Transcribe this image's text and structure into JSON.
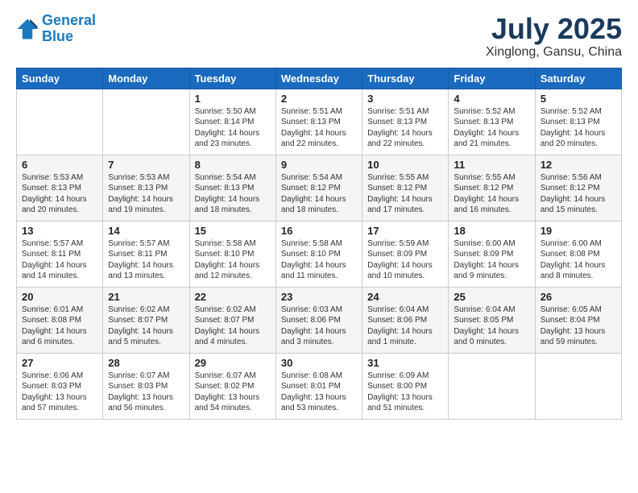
{
  "logo": {
    "line1": "General",
    "line2": "Blue"
  },
  "title": "July 2025",
  "location": "Xinglong, Gansu, China",
  "weekdays": [
    "Sunday",
    "Monday",
    "Tuesday",
    "Wednesday",
    "Thursday",
    "Friday",
    "Saturday"
  ],
  "weeks": [
    [
      {
        "day": "",
        "info": ""
      },
      {
        "day": "",
        "info": ""
      },
      {
        "day": "1",
        "info": "Sunrise: 5:50 AM\nSunset: 8:14 PM\nDaylight: 14 hours\nand 23 minutes."
      },
      {
        "day": "2",
        "info": "Sunrise: 5:51 AM\nSunset: 8:13 PM\nDaylight: 14 hours\nand 22 minutes."
      },
      {
        "day": "3",
        "info": "Sunrise: 5:51 AM\nSunset: 8:13 PM\nDaylight: 14 hours\nand 22 minutes."
      },
      {
        "day": "4",
        "info": "Sunrise: 5:52 AM\nSunset: 8:13 PM\nDaylight: 14 hours\nand 21 minutes."
      },
      {
        "day": "5",
        "info": "Sunrise: 5:52 AM\nSunset: 8:13 PM\nDaylight: 14 hours\nand 20 minutes."
      }
    ],
    [
      {
        "day": "6",
        "info": "Sunrise: 5:53 AM\nSunset: 8:13 PM\nDaylight: 14 hours\nand 20 minutes."
      },
      {
        "day": "7",
        "info": "Sunrise: 5:53 AM\nSunset: 8:13 PM\nDaylight: 14 hours\nand 19 minutes."
      },
      {
        "day": "8",
        "info": "Sunrise: 5:54 AM\nSunset: 8:13 PM\nDaylight: 14 hours\nand 18 minutes."
      },
      {
        "day": "9",
        "info": "Sunrise: 5:54 AM\nSunset: 8:12 PM\nDaylight: 14 hours\nand 18 minutes."
      },
      {
        "day": "10",
        "info": "Sunrise: 5:55 AM\nSunset: 8:12 PM\nDaylight: 14 hours\nand 17 minutes."
      },
      {
        "day": "11",
        "info": "Sunrise: 5:55 AM\nSunset: 8:12 PM\nDaylight: 14 hours\nand 16 minutes."
      },
      {
        "day": "12",
        "info": "Sunrise: 5:56 AM\nSunset: 8:12 PM\nDaylight: 14 hours\nand 15 minutes."
      }
    ],
    [
      {
        "day": "13",
        "info": "Sunrise: 5:57 AM\nSunset: 8:11 PM\nDaylight: 14 hours\nand 14 minutes."
      },
      {
        "day": "14",
        "info": "Sunrise: 5:57 AM\nSunset: 8:11 PM\nDaylight: 14 hours\nand 13 minutes."
      },
      {
        "day": "15",
        "info": "Sunrise: 5:58 AM\nSunset: 8:10 PM\nDaylight: 14 hours\nand 12 minutes."
      },
      {
        "day": "16",
        "info": "Sunrise: 5:58 AM\nSunset: 8:10 PM\nDaylight: 14 hours\nand 11 minutes."
      },
      {
        "day": "17",
        "info": "Sunrise: 5:59 AM\nSunset: 8:09 PM\nDaylight: 14 hours\nand 10 minutes."
      },
      {
        "day": "18",
        "info": "Sunrise: 6:00 AM\nSunset: 8:09 PM\nDaylight: 14 hours\nand 9 minutes."
      },
      {
        "day": "19",
        "info": "Sunrise: 6:00 AM\nSunset: 8:08 PM\nDaylight: 14 hours\nand 8 minutes."
      }
    ],
    [
      {
        "day": "20",
        "info": "Sunrise: 6:01 AM\nSunset: 8:08 PM\nDaylight: 14 hours\nand 6 minutes."
      },
      {
        "day": "21",
        "info": "Sunrise: 6:02 AM\nSunset: 8:07 PM\nDaylight: 14 hours\nand 5 minutes."
      },
      {
        "day": "22",
        "info": "Sunrise: 6:02 AM\nSunset: 8:07 PM\nDaylight: 14 hours\nand 4 minutes."
      },
      {
        "day": "23",
        "info": "Sunrise: 6:03 AM\nSunset: 8:06 PM\nDaylight: 14 hours\nand 3 minutes."
      },
      {
        "day": "24",
        "info": "Sunrise: 6:04 AM\nSunset: 8:06 PM\nDaylight: 14 hours\nand 1 minute."
      },
      {
        "day": "25",
        "info": "Sunrise: 6:04 AM\nSunset: 8:05 PM\nDaylight: 14 hours\nand 0 minutes."
      },
      {
        "day": "26",
        "info": "Sunrise: 6:05 AM\nSunset: 8:04 PM\nDaylight: 13 hours\nand 59 minutes."
      }
    ],
    [
      {
        "day": "27",
        "info": "Sunrise: 6:06 AM\nSunset: 8:03 PM\nDaylight: 13 hours\nand 57 minutes."
      },
      {
        "day": "28",
        "info": "Sunrise: 6:07 AM\nSunset: 8:03 PM\nDaylight: 13 hours\nand 56 minutes."
      },
      {
        "day": "29",
        "info": "Sunrise: 6:07 AM\nSunset: 8:02 PM\nDaylight: 13 hours\nand 54 minutes."
      },
      {
        "day": "30",
        "info": "Sunrise: 6:08 AM\nSunset: 8:01 PM\nDaylight: 13 hours\nand 53 minutes."
      },
      {
        "day": "31",
        "info": "Sunrise: 6:09 AM\nSunset: 8:00 PM\nDaylight: 13 hours\nand 51 minutes."
      },
      {
        "day": "",
        "info": ""
      },
      {
        "day": "",
        "info": ""
      }
    ]
  ]
}
